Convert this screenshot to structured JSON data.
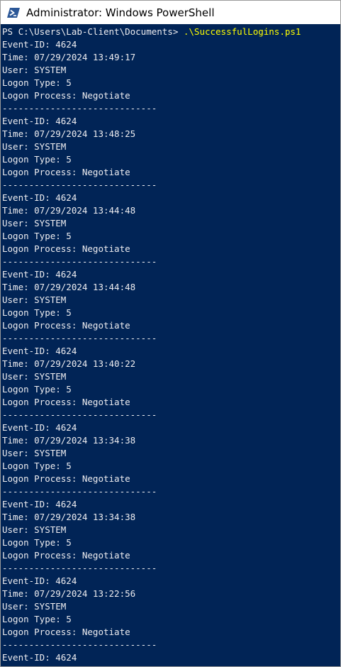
{
  "window": {
    "title": "Administrator: Windows PowerShell",
    "icon": "powershell-icon",
    "colors": {
      "console_bg": "#012456",
      "console_fg": "#eeedf0",
      "command_fg": "#ffff00",
      "icon_bg": "#2b5797"
    }
  },
  "console": {
    "prompt": "PS C:\\Users\\Lab-Client\\Documents> ",
    "command": ".\\SuccessfulLogins.ps1",
    "separator": "-----------------------------",
    "events": [
      {
        "event_id": "Event-ID: 4624",
        "time": "Time: 07/29/2024 13:49:17",
        "user": "User: SYSTEM",
        "logon_type": "Logon Type: 5",
        "logon_process": "Logon Process: Negotiate"
      },
      {
        "event_id": "Event-ID: 4624",
        "time": "Time: 07/29/2024 13:48:25",
        "user": "User: SYSTEM",
        "logon_type": "Logon Type: 5",
        "logon_process": "Logon Process: Negotiate"
      },
      {
        "event_id": "Event-ID: 4624",
        "time": "Time: 07/29/2024 13:44:48",
        "user": "User: SYSTEM",
        "logon_type": "Logon Type: 5",
        "logon_process": "Logon Process: Negotiate"
      },
      {
        "event_id": "Event-ID: 4624",
        "time": "Time: 07/29/2024 13:44:48",
        "user": "User: SYSTEM",
        "logon_type": "Logon Type: 5",
        "logon_process": "Logon Process: Negotiate"
      },
      {
        "event_id": "Event-ID: 4624",
        "time": "Time: 07/29/2024 13:40:22",
        "user": "User: SYSTEM",
        "logon_type": "Logon Type: 5",
        "logon_process": "Logon Process: Negotiate"
      },
      {
        "event_id": "Event-ID: 4624",
        "time": "Time: 07/29/2024 13:34:38",
        "user": "User: SYSTEM",
        "logon_type": "Logon Type: 5",
        "logon_process": "Logon Process: Negotiate"
      },
      {
        "event_id": "Event-ID: 4624",
        "time": "Time: 07/29/2024 13:34:38",
        "user": "User: SYSTEM",
        "logon_type": "Logon Type: 5",
        "logon_process": "Logon Process: Negotiate"
      },
      {
        "event_id": "Event-ID: 4624",
        "time": "Time: 07/29/2024 13:22:56",
        "user": "User: SYSTEM",
        "logon_type": "Logon Type: 5",
        "logon_process": "Logon Process: Negotiate"
      }
    ],
    "trailing_line": "Event-ID: 4624"
  }
}
